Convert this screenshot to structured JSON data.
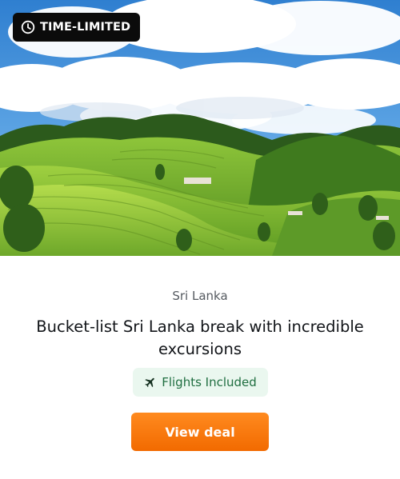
{
  "badge": {
    "label": "TIME-LIMITED",
    "icon": "clock-icon"
  },
  "hero": {
    "image": "tea-plantation-hills-photo"
  },
  "deal": {
    "destination": "Sri Lanka",
    "title": "Bucket-list Sri Lanka break with incredible excursions",
    "feature": {
      "label": "Flights Included",
      "icon": "airplane-icon"
    },
    "cta_label": "View deal"
  },
  "colors": {
    "cta": "#f47a10",
    "pill_background": "#eaf7ef",
    "pill_text": "#1f6e40",
    "badge_background": "#0b0b0b"
  }
}
